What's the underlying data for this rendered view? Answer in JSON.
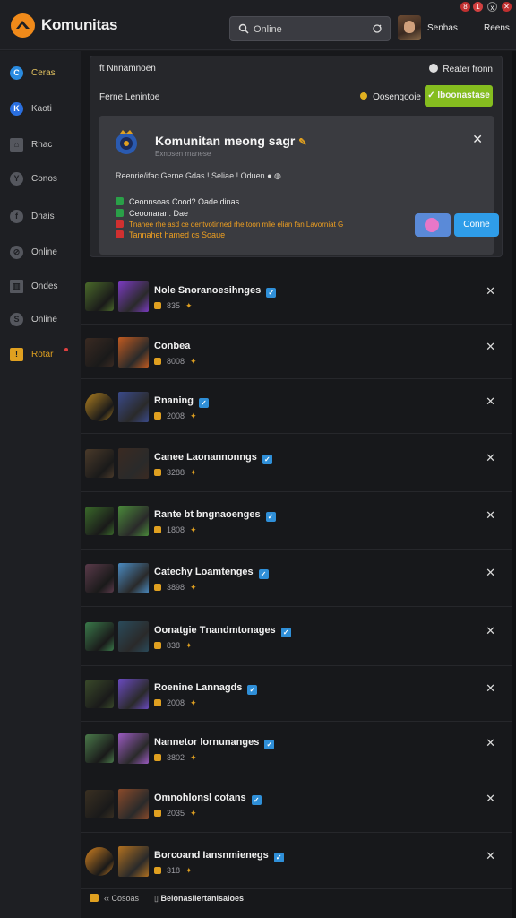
{
  "app": {
    "title": "Komunitas"
  },
  "header": {
    "search_value": "Online",
    "link_1": "Senhas",
    "link_2": "Reens",
    "notifications": [
      "8",
      "1",
      "x"
    ]
  },
  "sidebar": {
    "items": [
      {
        "label": "Ceras",
        "icon": "c-circle-icon",
        "color": "#2a8be0",
        "glyph": "C"
      },
      {
        "label": "Kaoti",
        "icon": "k-circle-icon",
        "color": "#2a6fe0",
        "glyph": "K"
      },
      {
        "label": "Rhac",
        "icon": "home-icon",
        "color": "#55575e",
        "glyph": "⌂"
      },
      {
        "label": "Conos",
        "icon": "y-circle-icon",
        "color": "#55575e",
        "glyph": "Y"
      },
      {
        "label": "Dnais",
        "icon": "f-circle-icon",
        "color": "#55575e",
        "glyph": "f"
      },
      {
        "label": "Online",
        "icon": "compass-icon",
        "color": "#55575e",
        "glyph": "⊘"
      },
      {
        "label": "Ondes",
        "icon": "columns-icon",
        "color": "#55575e",
        "glyph": "▥"
      },
      {
        "label": "Online",
        "icon": "s-circle-icon",
        "color": "#55575e",
        "glyph": "S"
      },
      {
        "label": "Rotar",
        "icon": "warning-icon",
        "color": "#e0a020",
        "glyph": "!"
      }
    ]
  },
  "panel": {
    "row1_left": "ft Nnnamnoen",
    "row1_right": "Reater fronn",
    "row2_left": "Ferne Lenintoe",
    "row2_right": "Oosenqooie",
    "cta_label": "Iboonastase"
  },
  "card": {
    "title": "Komunitan meong sagr",
    "subtitle": "Exnosen rnanese",
    "meta": "Reenrie/ifac  Gerne Gdas  !  Seliae  !  Oduen  ●  ◍",
    "lines": [
      {
        "text": "Ceonnsoas Cood? Oade dinas",
        "color": "#f0c040",
        "badge": "#2aa048"
      },
      {
        "text": "Ceoonaran: Dae",
        "color": "#f0f0f0",
        "badge": "#2aa048"
      },
      {
        "text": "Tnanee rhe asd ce dentvotinned rhe toon mlie elian fan Lavorniat G",
        "color": "#f0a020",
        "badge": "#d03030"
      },
      {
        "text": "Tannahet hamed cs Soaue",
        "color": "#f0a020",
        "badge": "#d03030"
      }
    ],
    "button_label": "Conne"
  },
  "members": [
    {
      "name": "Nole Snoranoesihnges",
      "verified": true,
      "stats": "835",
      "c1": "#4a6a2a",
      "c2": "#7a3ac0"
    },
    {
      "name": "Conbea",
      "verified": false,
      "stats": "8008",
      "c1": "#3a2a22",
      "c2": "#c05a20"
    },
    {
      "name": "Rnaning",
      "verified": true,
      "stats": "2008",
      "c1": "#b08020",
      "c2": "#3a4a8a"
    },
    {
      "name": "Canee Laonannonngs",
      "verified": true,
      "stats": "3288",
      "c1": "#4a3a2a",
      "c2": "#3a2a22"
    },
    {
      "name": "Rante bt bngnaoenges",
      "verified": true,
      "stats": "1808",
      "c1": "#3a6a2a",
      "c2": "#4a8a3a"
    },
    {
      "name": "Catechy Loamtenges",
      "verified": true,
      "stats": "3898",
      "c1": "#5a3a4a",
      "c2": "#4a8ac0"
    },
    {
      "name": "Oonatgie Tnandmtonages",
      "verified": true,
      "stats": "838",
      "c1": "#3a7a4a",
      "c2": "#2a4a5a"
    },
    {
      "name": "Roenine Lannagds",
      "verified": true,
      "stats": "2008",
      "c1": "#3a4a2a",
      "c2": "#6a4ac0"
    },
    {
      "name": "Nannetor lornunanges",
      "verified": true,
      "stats": "3802",
      "c1": "#4a7a4a",
      "c2": "#9a5ac0"
    },
    {
      "name": "Omnohlonsl cotans",
      "verified": true,
      "stats": "2035",
      "c1": "#3a3022",
      "c2": "#8a4a2a"
    },
    {
      "name": "Borcoand Iansnmienegs",
      "verified": true,
      "stats": "318",
      "c1": "#d08020",
      "c2": "#b07020"
    }
  ],
  "footer": {
    "left": "Cosoas",
    "right": "Belonasiiertanlsaloes"
  },
  "colors": {
    "accent": "#85bd1f",
    "brand": "#f08a1a",
    "link_blue": "#2f9de9"
  }
}
